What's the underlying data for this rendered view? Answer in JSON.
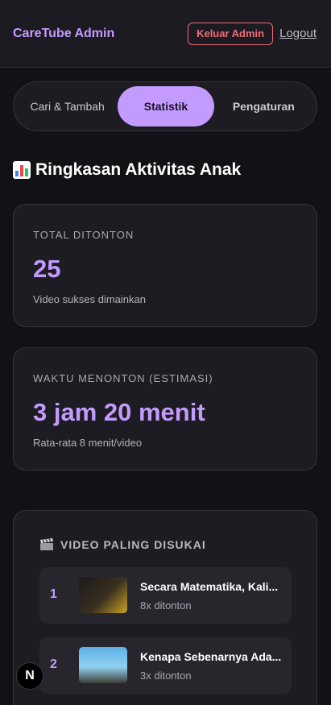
{
  "header": {
    "brand": "CareTube Admin",
    "exit_label": "Keluar Admin",
    "logout_label": "Logout"
  },
  "tabs": [
    {
      "label": "Cari & Tambah",
      "active": false
    },
    {
      "label": "Statistik",
      "active": true
    },
    {
      "label": "Pengaturan",
      "active": false
    }
  ],
  "section": {
    "title": "Ringkasan Aktivitas Anak",
    "icon": "bar-chart-icon"
  },
  "stats": {
    "total": {
      "label": "TOTAL DITONTON",
      "value": "25",
      "sub": "Video sukses dimainkan"
    },
    "time": {
      "label": "WAKTU MENONTON (ESTIMASI)",
      "value": "3 jam 20 menit",
      "sub": "Rata-rata 8 menit/video"
    }
  },
  "favorites": {
    "title": "VIDEO PALING DISUKAI",
    "icon": "clapperboard-icon",
    "items": [
      {
        "rank": "1",
        "title": "Secara Matematika, Kali...",
        "count": "8x ditonton"
      },
      {
        "rank": "2",
        "title": "Kenapa Sebenarnya Ada...",
        "count": "3x ditonton"
      }
    ]
  },
  "badge": {
    "label": "N"
  },
  "colors": {
    "accent": "#c39bff",
    "danger": "#ef6c75",
    "background": "#121116",
    "card": "#1d1c22"
  }
}
